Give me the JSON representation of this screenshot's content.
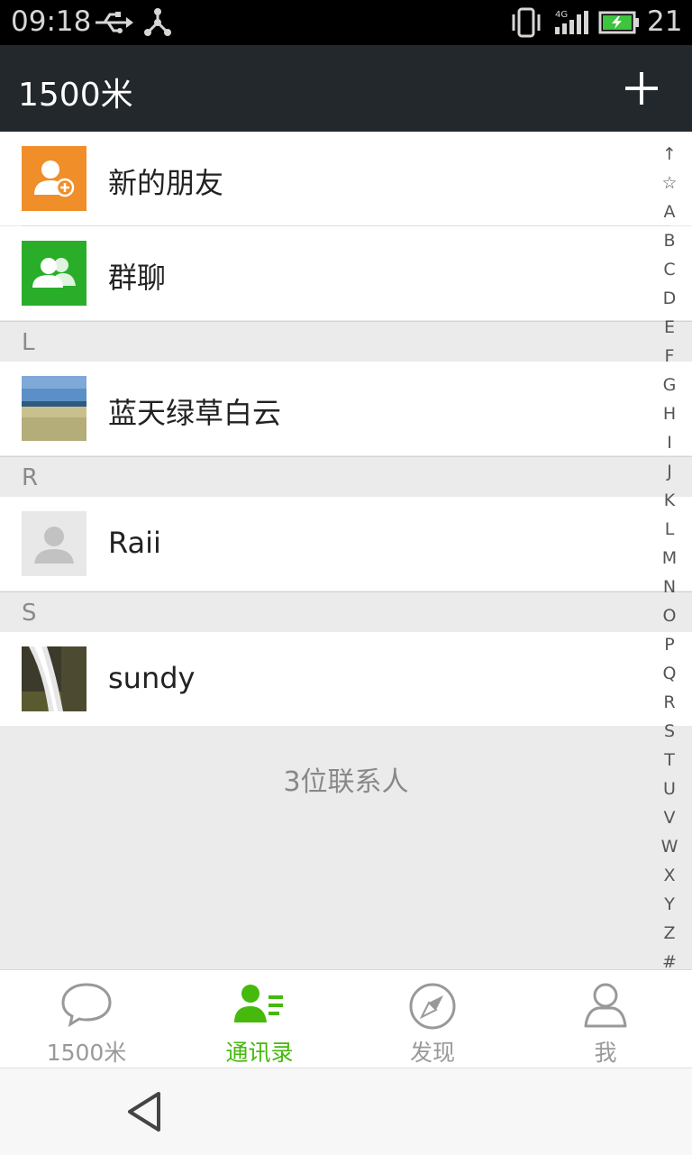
{
  "status_bar": {
    "time": "09:18",
    "battery": "21"
  },
  "header": {
    "title": "1500米"
  },
  "list": {
    "new_friends": "新的朋友",
    "group_chat": "群聊",
    "sections": [
      {
        "letter": "L",
        "contact": "蓝天绿草白云"
      },
      {
        "letter": "R",
        "contact": "Raii"
      },
      {
        "letter": "S",
        "contact": "sundy"
      }
    ],
    "count": "3位联系人"
  },
  "index_letters": [
    "↑",
    "☆",
    "A",
    "B",
    "C",
    "D",
    "E",
    "F",
    "G",
    "H",
    "I",
    "J",
    "K",
    "L",
    "M",
    "N",
    "O",
    "P",
    "Q",
    "R",
    "S",
    "T",
    "U",
    "V",
    "W",
    "X",
    "Y",
    "Z",
    "#"
  ],
  "tabs": [
    {
      "label": "1500米",
      "icon": "chat-bubble-icon",
      "active": false
    },
    {
      "label": "通讯录",
      "icon": "contacts-icon",
      "active": true
    },
    {
      "label": "发现",
      "icon": "compass-icon",
      "active": false
    },
    {
      "label": "我",
      "icon": "person-icon",
      "active": false
    }
  ],
  "colors": {
    "accent": "#45b90c",
    "header_bg": "#22282b",
    "new_friends_bg": "#f08e2a",
    "group_chat_bg": "#2aae2a"
  }
}
